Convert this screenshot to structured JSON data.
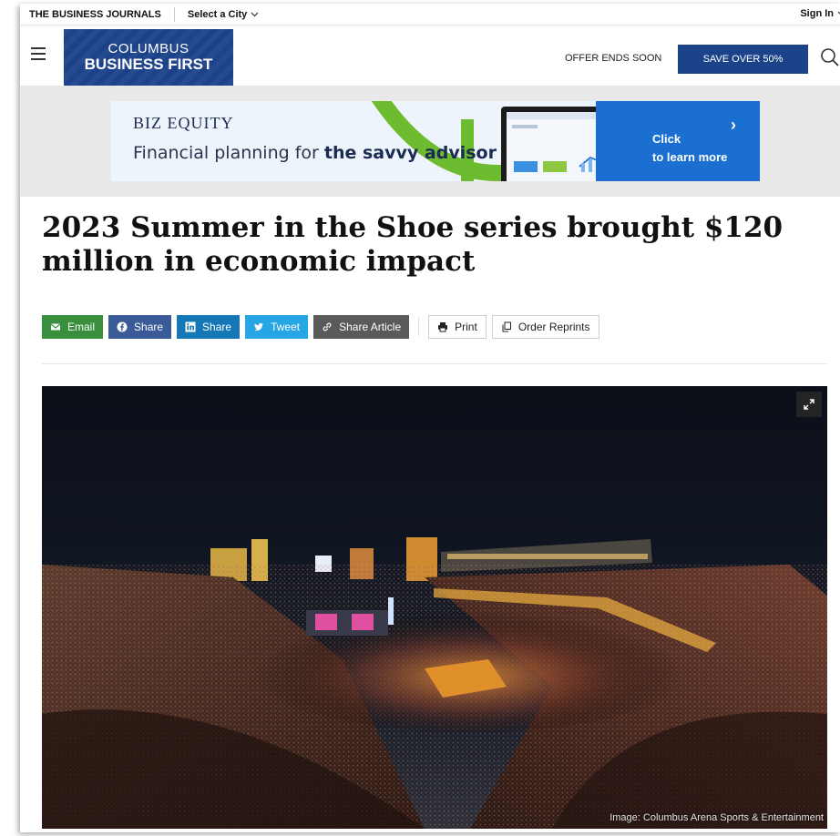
{
  "utility": {
    "brand": "THE BUSINESS JOURNALS",
    "city_select": "Select a City",
    "sign_in": "Sign In"
  },
  "header": {
    "logo_line1": "COLUMBUS",
    "logo_line2": "BUSINESS FIRST",
    "offer_text": "OFFER ENDS SOON",
    "save_button": "SAVE OVER 50%"
  },
  "ad": {
    "brand": "BIZ EQUITY",
    "tagline_prefix": "Financial planning for ",
    "tagline_bold": "the savvy advisor",
    "cta_line1": "Click",
    "cta_line2": "to learn more"
  },
  "article": {
    "headline": "2023 Summer in the Shoe series brought $120 million in economic impact",
    "share": {
      "email": "Email",
      "facebook": "Share",
      "linkedin": "Share",
      "twitter": "Tweet",
      "share_article": "Share Article",
      "print": "Print",
      "order_reprints": "Order Reprints"
    },
    "image_caption": "Image: Columbus Arena Sports & Entertainment"
  },
  "colors": {
    "brand_blue": "#1c4389",
    "email_green": "#3a8f3f",
    "facebook_blue": "#3b5a98",
    "linkedin_blue": "#1478b6",
    "twitter_blue": "#27a6e5",
    "article_gray": "#5a5a5a",
    "cta_blue": "#1a6fd1"
  }
}
